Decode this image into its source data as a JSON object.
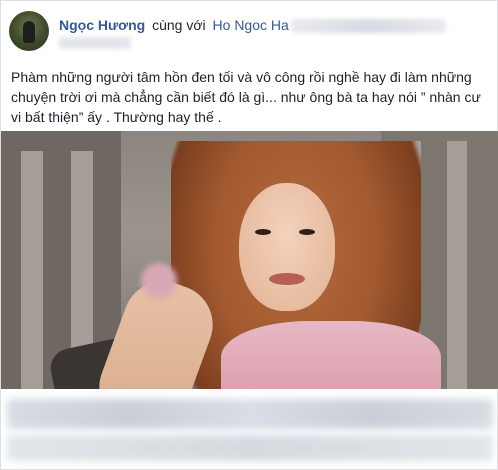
{
  "post": {
    "author": "Ngọc Hương",
    "with_text": "cùng với",
    "tagged": "Ho Ngoc Ha",
    "caption": "Phàm những người tâm hồn đen tối và vô công rồi nghề hay đi làm những chuyện trời ơi mà chẳng cần biết đó là gì... như ông bà ta hay nói ” nhàn cư vi bất thiện” ấy . Thường hay thế ."
  },
  "colors": {
    "link": "#365899",
    "text": "#1d2129",
    "border": "#dddfe2"
  }
}
